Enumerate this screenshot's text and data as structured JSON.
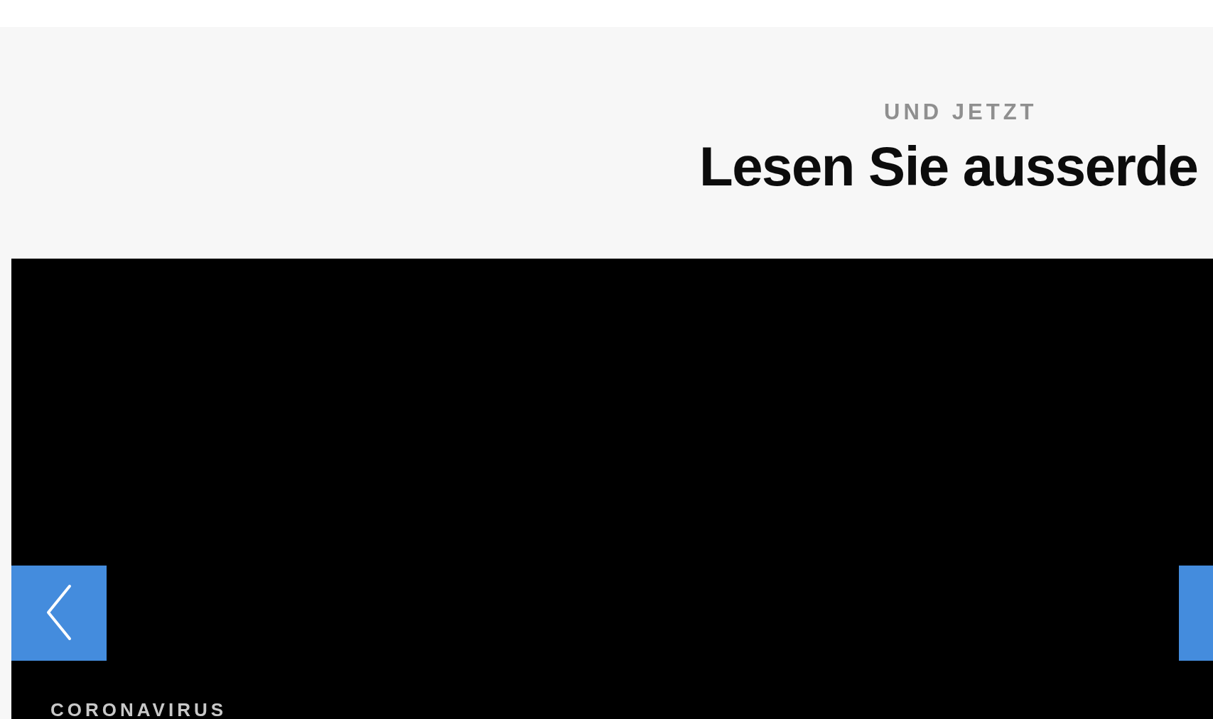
{
  "section": {
    "eyebrow": "UND JETZT",
    "title": "Lesen Sie ausserde"
  },
  "carousel": {
    "slide": {
      "category": "CORONAVIRUS"
    }
  }
}
